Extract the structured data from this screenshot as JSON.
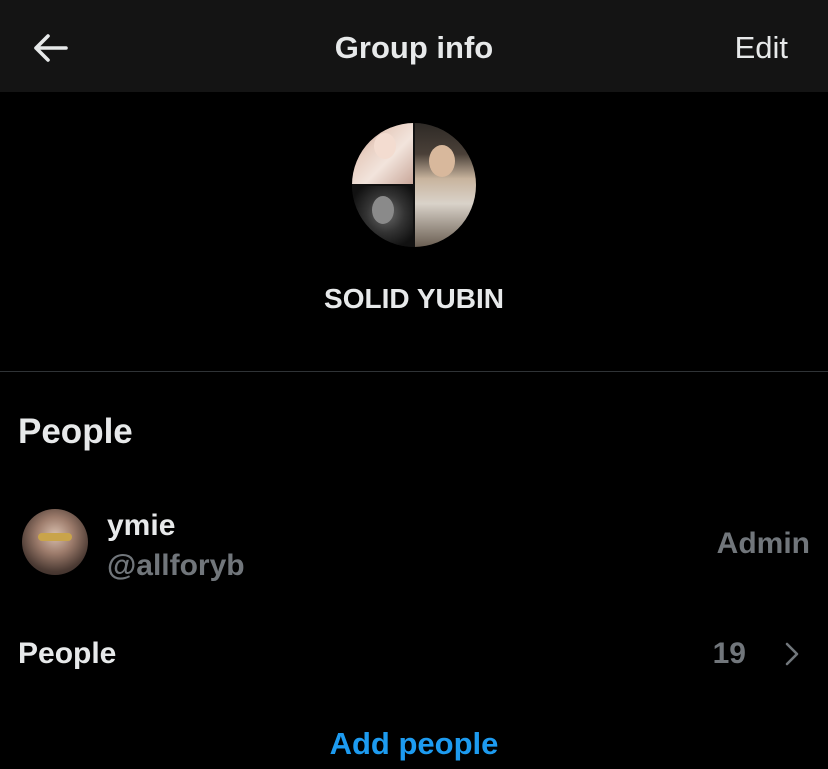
{
  "header": {
    "back_icon": "arrow-left-icon",
    "title": "Group info",
    "edit_label": "Edit"
  },
  "group": {
    "name": "SOLID YUBIN",
    "avatar": "group-collage-avatar"
  },
  "people_section": {
    "title": "People",
    "members": [
      {
        "name": "ymie",
        "handle": "@allforyb",
        "role": "Admin"
      }
    ],
    "people_row": {
      "label": "People",
      "count": "19",
      "chevron_icon": "chevron-right-icon"
    },
    "add_people_label": "Add people"
  },
  "colors": {
    "background": "#000000",
    "header_background": "#141414",
    "primary_text": "#e7e9ea",
    "secondary_text": "#71767b",
    "accent": "#1d9bf0",
    "divider": "#2f3336"
  }
}
